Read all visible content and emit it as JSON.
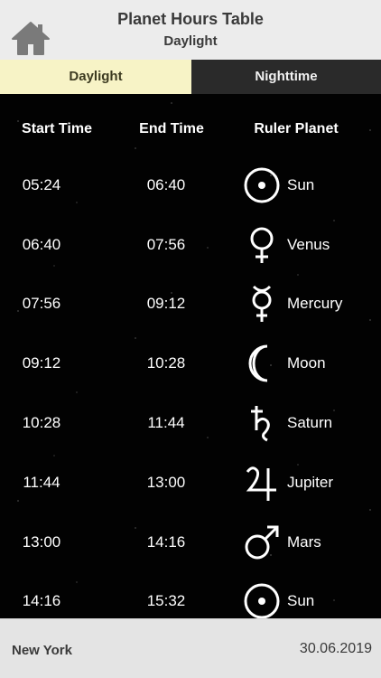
{
  "header": {
    "title": "Planet Hours Table",
    "subtitle": "Daylight"
  },
  "tabs": [
    {
      "label": "Daylight",
      "active": true
    },
    {
      "label": "Nighttime",
      "active": false
    }
  ],
  "columns": {
    "start": "Start Time",
    "end": "End Time",
    "ruler": "Ruler Planet"
  },
  "rows": [
    {
      "start": "05:24",
      "end": "06:40",
      "planet": "Sun",
      "icon": "sun-icon"
    },
    {
      "start": "06:40",
      "end": "07:56",
      "planet": "Venus",
      "icon": "venus-icon"
    },
    {
      "start": "07:56",
      "end": "09:12",
      "planet": "Mercury",
      "icon": "mercury-icon"
    },
    {
      "start": "09:12",
      "end": "10:28",
      "planet": "Moon",
      "icon": "moon-icon"
    },
    {
      "start": "10:28",
      "end": "11:44",
      "planet": "Saturn",
      "icon": "saturn-icon"
    },
    {
      "start": "11:44",
      "end": "13:00",
      "planet": "Jupiter",
      "icon": "jupiter-icon"
    },
    {
      "start": "13:00",
      "end": "14:16",
      "planet": "Mars",
      "icon": "mars-icon"
    },
    {
      "start": "14:16",
      "end": "15:32",
      "planet": "Sun",
      "icon": "sun-icon"
    }
  ],
  "footer": {
    "city": "New York",
    "date": "30.06.2019"
  },
  "colors": {
    "header_bg": "#ececec",
    "active_tab": "#f7f3c6",
    "inactive_tab": "#2a2a2a",
    "sky": "#020202"
  }
}
